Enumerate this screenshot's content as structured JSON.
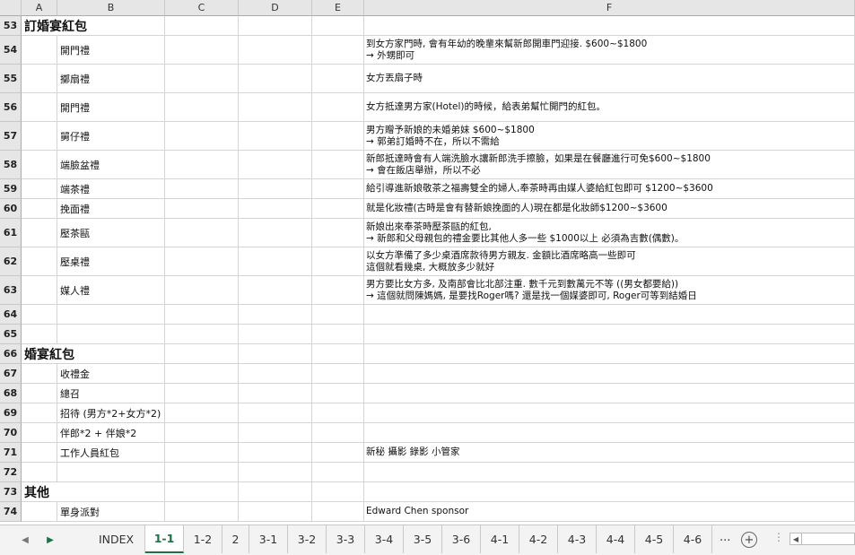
{
  "columns": [
    "A",
    "B",
    "C",
    "D",
    "E",
    "F"
  ],
  "rows": [
    {
      "num": "53",
      "section": "訂婚宴紅包",
      "b": "",
      "f": []
    },
    {
      "num": "54",
      "section": "",
      "b": "開門禮",
      "f": [
        "到女方家門時, 會有年幼的晚輩來幫新郎開車門迎接. $600~$1800",
        "→ 外甥即可"
      ]
    },
    {
      "num": "55",
      "section": "",
      "b": "擲扇禮",
      "f": [
        "女方丟扇子時"
      ]
    },
    {
      "num": "56",
      "section": "",
      "b": "開門禮",
      "f": [
        "女方抵達男方家(Hotel)的時候，給表弟幫忙開門的紅包。"
      ]
    },
    {
      "num": "57",
      "section": "",
      "b": "舅仔禮",
      "f": [
        "男方贈予新娘的未婚弟妹 $600~$1800",
        "→ 郭弟訂婚時不在，所以不需給"
      ]
    },
    {
      "num": "58",
      "section": "",
      "b": "端臉盆禮",
      "f": [
        "新郎抵達時會有人端洗臉水讓新郎洗手擦臉，如果是在餐廳進行可免$600~$1800",
        "→ 會在飯店舉辦，所以不必"
      ]
    },
    {
      "num": "59",
      "section": "",
      "b": "端茶禮",
      "f": [
        "給引導進新娘敬茶之福壽雙全的婦人,奉茶時再由媒人婆給紅包即可 $1200~$3600"
      ]
    },
    {
      "num": "60",
      "section": "",
      "b": "挽面禮",
      "f": [
        "就是化妝禮(古時是會有替新娘挽面的人)現在都是化妝師$1200~$3600"
      ]
    },
    {
      "num": "61",
      "section": "",
      "b": "壓茶甌",
      "f": [
        "新娘出來奉茶時壓茶甌的紅包,",
        "→    新郎和父母親包的禮金要比其他人多一些 $1000以上 必須為吉數(偶數)。"
      ]
    },
    {
      "num": "62",
      "section": "",
      "b": "壓桌禮",
      "f": [
        "以女方準備了多少桌酒席款待男方親友. 金額比酒席略高一些即可",
        "這個就看幾桌, 大概放多少就好"
      ]
    },
    {
      "num": "63",
      "section": "",
      "b": "媒人禮",
      "f": [
        "男方要比女方多, 及南部會比北部注重. 數千元到數萬元不等 ((男女都要給))",
        "→    這個就問陳媽媽, 是要找Roger嗎? 還是找一個媒婆即可, Roger可等到結婚日"
      ]
    },
    {
      "num": "64",
      "section": "",
      "b": "",
      "f": []
    },
    {
      "num": "65",
      "section": "",
      "b": "",
      "f": []
    },
    {
      "num": "66",
      "section": "婚宴紅包",
      "b": "",
      "f": []
    },
    {
      "num": "67",
      "section": "",
      "b": "收禮金",
      "f": []
    },
    {
      "num": "68",
      "section": "",
      "b": "總召",
      "f": []
    },
    {
      "num": "69",
      "section": "",
      "b": "招待 (男方*2+女方*2)",
      "f": []
    },
    {
      "num": "70",
      "section": "",
      "b": "伴郎*2 + 伴娘*2",
      "f": []
    },
    {
      "num": "71",
      "section": "",
      "b": "工作人員紅包",
      "f": [
        "新秘 攝影 錄影 小管家"
      ]
    },
    {
      "num": "72",
      "section": "",
      "b": "",
      "f": []
    },
    {
      "num": "73",
      "section": "其他",
      "b": "",
      "f": []
    },
    {
      "num": "74",
      "section": "",
      "b": "單身派對",
      "f": [
        "Edward Chen sponsor"
      ]
    }
  ],
  "tabs": [
    "INDEX",
    "1-1",
    "1-2",
    "2",
    "3-1",
    "3-2",
    "3-3",
    "3-4",
    "3-5",
    "3-6",
    "4-1",
    "4-2",
    "4-3",
    "4-4",
    "4-5",
    "4-6"
  ],
  "active_tab": "1-1",
  "more_tabs_label": "...",
  "colors": {
    "accent": "#1e7145",
    "header_bg": "#e6e6e6",
    "gridline": "#d4d4d4"
  }
}
